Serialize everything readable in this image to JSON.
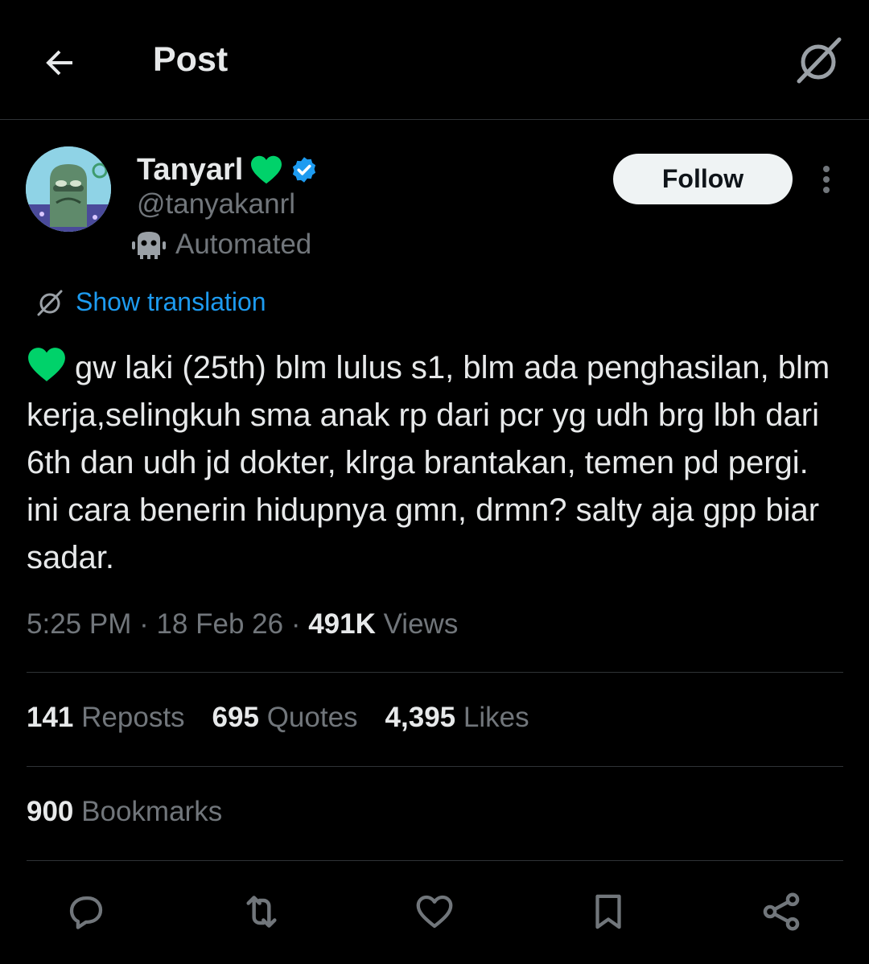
{
  "header": {
    "title": "Post",
    "back_icon": "arrow-left-icon",
    "grok_icon": "grok-icon"
  },
  "author": {
    "name": "Tanyarl",
    "name_emoji": "green-heart-emoji",
    "verified_icon": "verified-badge-icon",
    "handle": "@tanyakanrl",
    "automated_label": "Automated",
    "automated_icon": "bot-icon"
  },
  "follow_label": "Follow",
  "translation": {
    "label": "Show translation",
    "icon": "grok-icon"
  },
  "tweet": {
    "text": "gw laki (25th) blm lulus s1, blm ada penghasilan, blm kerja,selingkuh sma anak rp dari pcr yg udh brg lbh dari 6th dan udh jd dokter, klrga brantakan, temen pd pergi. ini cara benerin hidupnya gmn, drmn? salty aja gpp biar sadar."
  },
  "meta": {
    "time": "5:25 PM",
    "sep1": " · ",
    "date": "18 Feb 26",
    "sep2": " · ",
    "views_count": "491K",
    "views_label": " Views"
  },
  "stats": {
    "reposts_count": "141",
    "reposts_label": "Reposts",
    "quotes_count": "695",
    "quotes_label": "Quotes",
    "likes_count": "4,395",
    "likes_label": "Likes",
    "bookmarks_count": "900",
    "bookmarks_label": "Bookmarks"
  },
  "actions": [
    "reply-icon",
    "repost-icon",
    "like-icon",
    "bookmark-icon",
    "share-icon"
  ],
  "colors": {
    "background": "#000000",
    "text": "#e7e9ea",
    "muted": "#71767b",
    "link": "#1d9bf0",
    "verified": "#1d9bf0",
    "heart": "#00d26a"
  }
}
